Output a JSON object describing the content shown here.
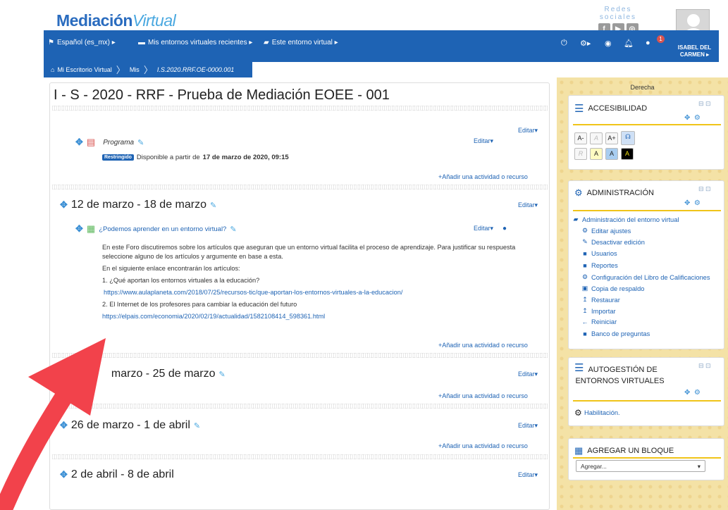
{
  "header": {
    "logo_part1": "Mediación",
    "logo_part2": "Virtual",
    "social_label": "Redes sociales",
    "social_icons": [
      "f",
      "▶",
      "◎"
    ],
    "username": "ISABEL DEL CARMEN ▸"
  },
  "nav": {
    "language": "Español (es_mx) ▸",
    "recent": "Mis entornos virtuales recientes ▸",
    "this_env": "Este entorno virtual ▸",
    "notifications_count": "1"
  },
  "breadcrumb": {
    "home": "Mi Escritorio Virtual",
    "mis": "Mis",
    "current": "I.S.2020.RRF.OE-0000.001"
  },
  "right_region_label": "Derecha",
  "course": {
    "title": "I - S - 2020 - RRF - Prueba de Mediación EOEE - 001",
    "edit_label": "Editar▾",
    "add_label": "Añadir una actividad o recurso",
    "section0": {
      "activity_name": "Programa",
      "restricted_badge": "Restringido",
      "availability_prefix": "Disponible a partir de",
      "availability_date": "17 de marzo de 2020, 09:15"
    },
    "section1": {
      "title": "12 de marzo - 18 de marzo",
      "forum_name": "¿Podemos aprender en un entorno virtual?",
      "desc1": "En este Foro discutiremos sobre los artículos que aseguran que un entorno virtual facilita el proceso de aprendizaje. Para justificar su respuesta seleccione alguno de los artículos y argumente en base a esta.",
      "desc2": "En el siguiente enlace encontrarán los artículos:",
      "desc3": "1. ¿Qué aportan los entornos virtuales a la educación?",
      "link1": "https://www.aulaplaneta.com/2018/07/25/recursos-tic/que-aportan-los-entornos-virtuales-a-la-educacion/",
      "desc4": "2. El Internet de los profesores para cambiar la educación del futuro",
      "link2": "https://elpais.com/economia/2020/02/19/actualidad/1582108414_598361.html"
    },
    "section2": {
      "title": "marzo - 25 de marzo"
    },
    "section3": {
      "title": "26 de marzo - 1 de abril"
    },
    "section4": {
      "title": "2 de abril - 8 de abril"
    }
  },
  "blocks": {
    "accessibility": {
      "title": "ACCESIBILIDAD",
      "buttons_row1": [
        "A-",
        "A",
        "A+"
      ],
      "buttons_row2": [
        "R",
        "A",
        "A",
        "A"
      ]
    },
    "administration": {
      "title": "ADMINISTRACIÓN",
      "root": "Administración del entorno virtual",
      "items": [
        "Editar ajustes",
        "Desactivar edición",
        "Usuarios",
        "Reportes",
        "Configuración del Libro de Calificaciones",
        "Copia de respaldo",
        "Restaurar",
        "Importar",
        "Reiniciar",
        "Banco de preguntas"
      ]
    },
    "self_management": {
      "title_line1": "AUTOGESTIÓN DE",
      "title_line2": "ENTORNOS VIRTUALES",
      "item": "Habilitación."
    },
    "add_block": {
      "title": "AGREGAR UN BLOQUE",
      "select_value": "Agregar..."
    }
  },
  "colors": {
    "brand_blue": "#1e63b4",
    "accent_yellow": "#f0c419",
    "arrow_red": "#f2424b"
  }
}
